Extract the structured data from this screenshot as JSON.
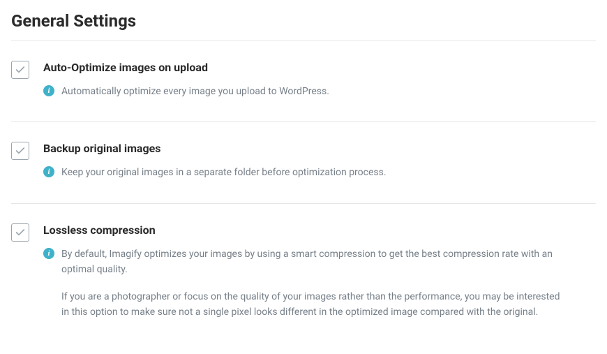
{
  "page_title": "General Settings",
  "settings": [
    {
      "label": "Auto-Optimize images on upload",
      "description": [
        "Automatically optimize every image you upload to WordPress."
      ]
    },
    {
      "label": "Backup original images",
      "description": [
        "Keep your original images in a separate folder before optimization process."
      ]
    },
    {
      "label": "Lossless compression",
      "description": [
        "By default, Imagify optimizes your images by using a smart compression to get the best compression rate with an optimal quality.",
        "If you are a photographer or focus on the quality of your images rather than the performance, you may be interested in this option to make sure not a single pixel looks different in the optimized image compared with the original."
      ]
    }
  ]
}
